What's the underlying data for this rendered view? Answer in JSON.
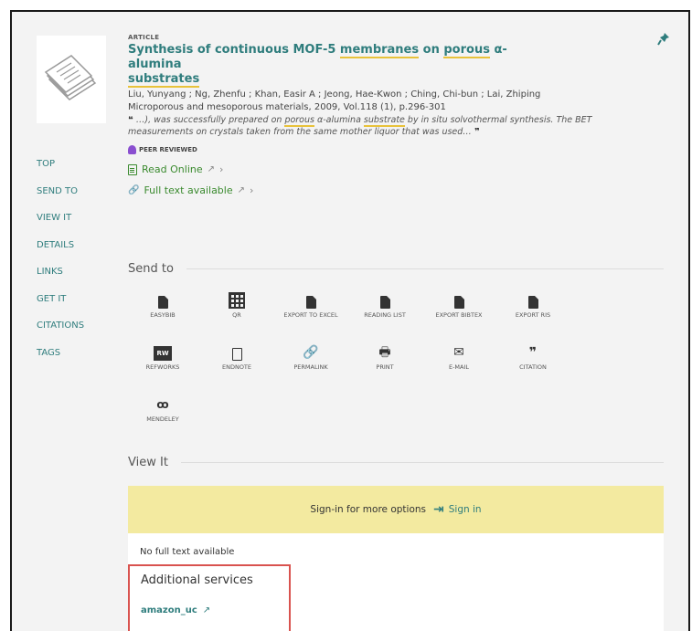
{
  "record": {
    "type": "Article",
    "title_parts": [
      "Synthesis of continuous MOF-5 ",
      "membranes",
      " on ",
      "porous",
      " α-alumina ",
      "substrates"
    ],
    "authors": "Liu, Yunyang ; Ng, Zhenfu ; Khan, Easir A ; Jeong, Hae-Kwon ; Ching, Chi-bun ; Lai, Zhiping",
    "source": "Microporous and mesoporous materials, 2009, Vol.118 (1), p.296-301",
    "snippet_parts": [
      "…), was successfully prepared on ",
      "porous",
      " α-alumina ",
      "substrate",
      " by in situ solvothermal synthesis. The BET measurements on crystals taken from the same mother liquor that was used…"
    ],
    "peer_reviewed": "PEER REVIEWED",
    "read_online": "Read Online",
    "full_text": "Full text available"
  },
  "leftnav": [
    "TOP",
    "SEND TO",
    "VIEW IT",
    "DETAILS",
    "LINKS",
    "GET IT",
    "CITATIONS",
    "TAGS"
  ],
  "send_to": {
    "heading": "Send to",
    "tiles": [
      "EASYBIB",
      "QR",
      "EXPORT TO EXCEL",
      "READING LIST",
      "EXPORT BIBTEX",
      "EXPORT RIS",
      "REFWORKS",
      "ENDNOTE",
      "PERMALINK",
      "PRINT",
      "E-MAIL",
      "CITATION",
      "MENDELEY"
    ],
    "refworks_badge": "RW"
  },
  "view_it": {
    "heading": "View It",
    "signin_text": "Sign-in for more options",
    "signin_button": "Sign in",
    "no_full_text": "No full text available",
    "additional_services": "Additional services",
    "amazon_link": "amazon_uc"
  }
}
